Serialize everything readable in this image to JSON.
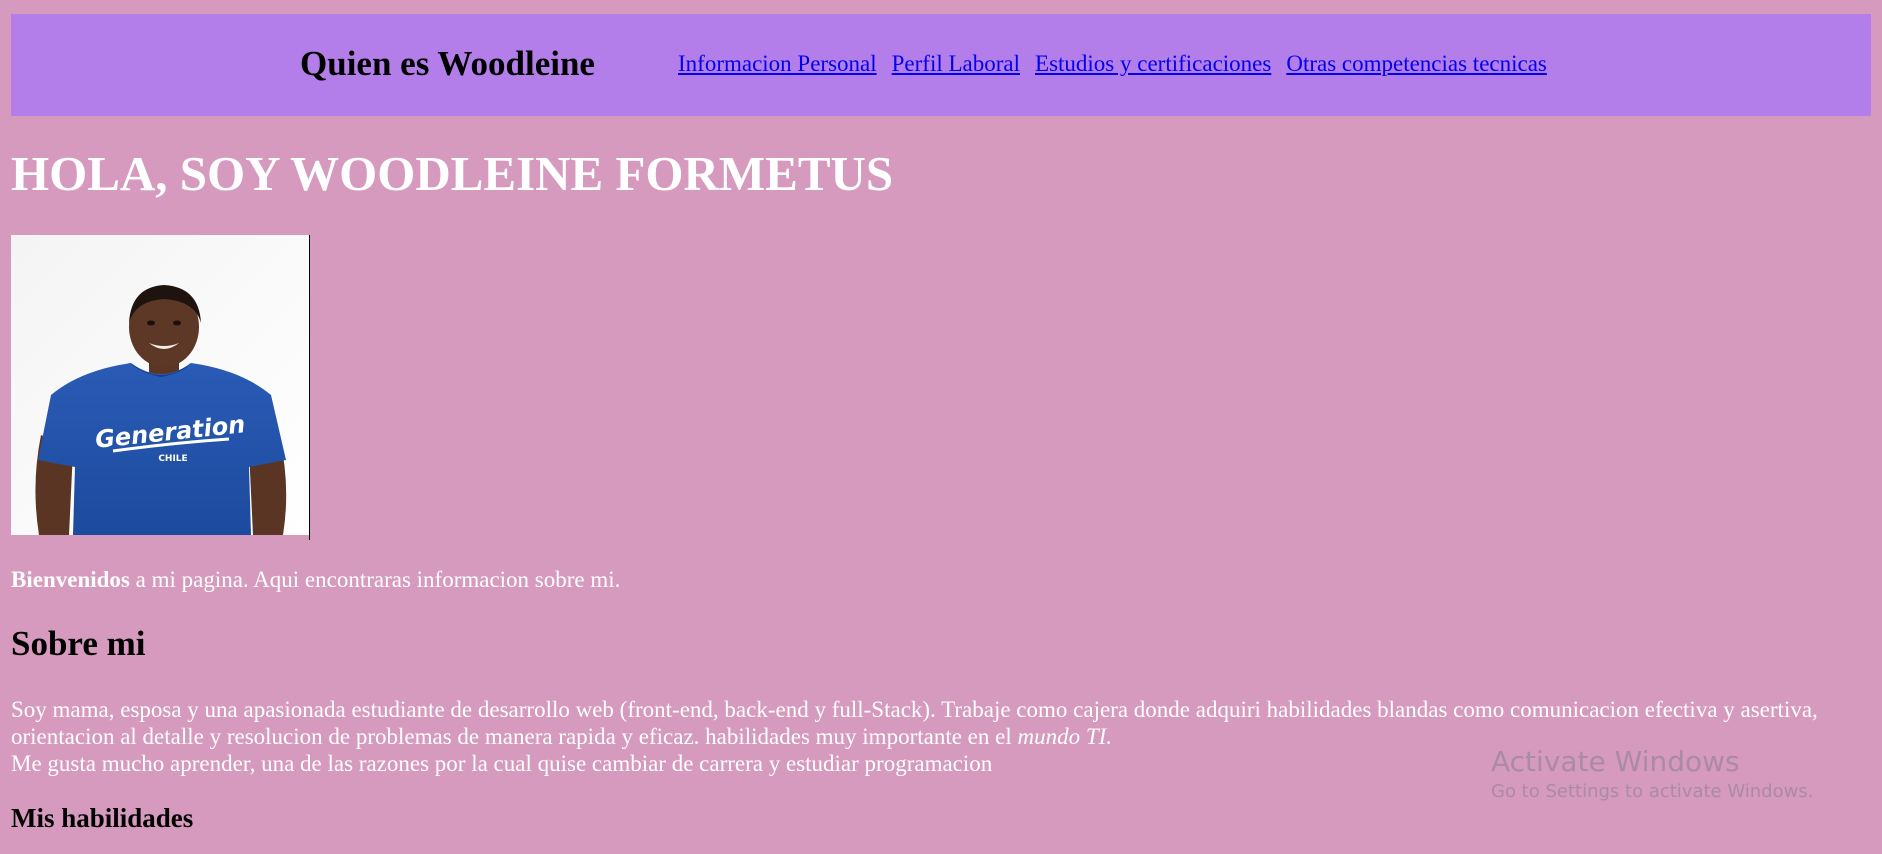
{
  "header": {
    "site_title": "Quien es Woodleine",
    "nav": [
      {
        "label": "Informacion Personal"
      },
      {
        "label": "Perfil Laboral"
      },
      {
        "label": "Estudios y certificaciones"
      },
      {
        "label": "Otras competencias tecnicas"
      }
    ]
  },
  "hero": {
    "title": "HOLA, SOY WOODLEINE FORMETUS",
    "photo_shirt_text": "Generation",
    "photo_shirt_subtext": "CHILE"
  },
  "welcome": {
    "bold": "Bienvenidos",
    "rest": " a mi pagina. Aqui encontraras informacion sobre mi."
  },
  "about": {
    "heading": "Sobre mi",
    "paragraph_part1": "Soy mama, esposa y una apasionada estudiante de desarrollo web (front-end, back-end y full-Stack). Trabaje como cajera donde adquiri habilidades blandas como comunicacion efectiva y asertiva, orientacion al detalle y resolucion de problemas de manera rapida y eficaz. habilidades muy importante en el ",
    "paragraph_italic": "mundo TI.",
    "line2": "Me gusta mucho aprender, una de las razones por la cual quise cambiar de carrera y estudiar programacion"
  },
  "skills": {
    "heading": "Mis habilidades"
  },
  "watermark": {
    "title": "Activate Windows",
    "subtitle": "Go to Settings to activate Windows."
  },
  "colors": {
    "page_background": "#d59abd",
    "header_background": "#b37dea",
    "link": "#0000ee"
  }
}
